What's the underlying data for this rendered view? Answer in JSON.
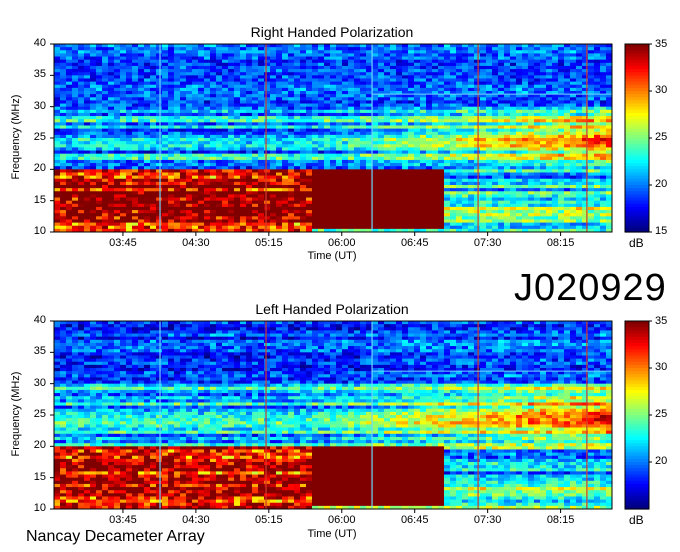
{
  "observation_id": "J020929",
  "footer_text": "Nancay Decameter Array",
  "chart_data": [
    {
      "type": "heatmap",
      "title": "Right Handed Polarization",
      "xlabel": "Time (UT)",
      "ylabel": "Frequency (MHz)",
      "x_ticks": [
        "03:45",
        "04:30",
        "05:15",
        "06:00",
        "06:45",
        "07:30",
        "08:15"
      ],
      "y_ticks": [
        "10",
        "15",
        "20",
        "25",
        "30",
        "35",
        "40"
      ],
      "ylim": [
        10,
        40
      ],
      "colorbar": {
        "label": "dB",
        "ticks": [
          "15",
          "20",
          "25",
          "30",
          "35"
        ],
        "range": [
          15,
          35
        ],
        "colormap": "jet"
      }
    },
    {
      "type": "heatmap",
      "title": "Left Handed Polarization",
      "xlabel": "Time (UT)",
      "ylabel": "Frequency (MHz)",
      "x_ticks": [
        "03:45",
        "04:30",
        "05:15",
        "06:00",
        "06:45",
        "07:30",
        "08:15"
      ],
      "y_ticks": [
        "10",
        "15",
        "20",
        "25",
        "30",
        "35",
        "40"
      ],
      "ylim": [
        10,
        40
      ],
      "colorbar": {
        "label": "dB",
        "ticks": [
          "20",
          "25",
          "30",
          "35"
        ],
        "range": [
          15,
          35
        ],
        "colormap": "jet"
      }
    }
  ]
}
